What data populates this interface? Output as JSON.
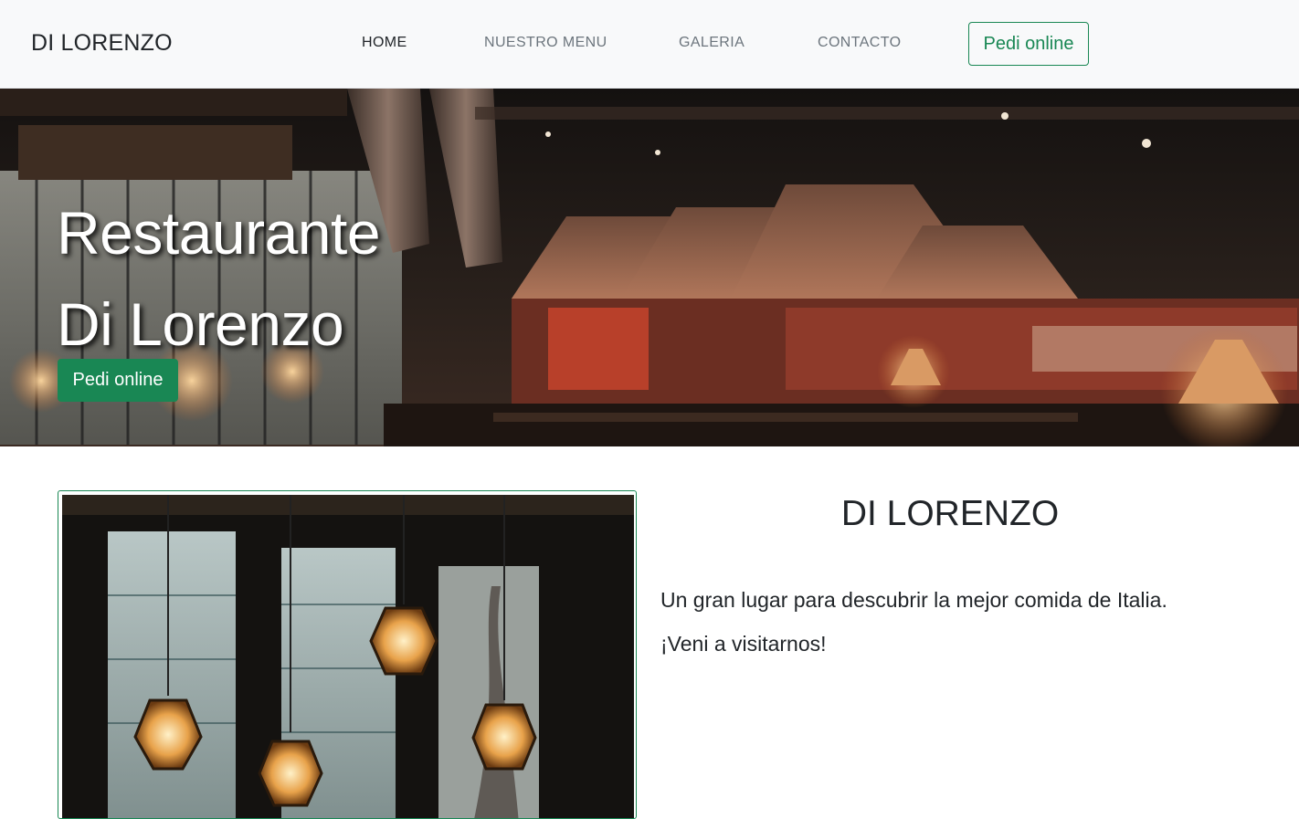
{
  "nav": {
    "brand": "DI LORENZO",
    "links": [
      {
        "label": "HOME",
        "active": true
      },
      {
        "label": "NUESTRO MENU",
        "active": false
      },
      {
        "label": "GALERIA",
        "active": false
      },
      {
        "label": "CONTACTO",
        "active": false
      }
    ],
    "cta_label": "Pedi online"
  },
  "hero": {
    "title_line1": "Restaurante",
    "title_line2": "Di Lorenzo",
    "cta_label": "Pedi online"
  },
  "about": {
    "title": "DI LORENZO",
    "line1": "Un gran lugar para descubrir la mejor comida de Italia.",
    "line2": "¡Veni a visitarnos!"
  },
  "colors": {
    "accent": "#198754",
    "navbar_bg": "#f8f9fa",
    "text": "#212529",
    "muted": "#6c757d"
  }
}
